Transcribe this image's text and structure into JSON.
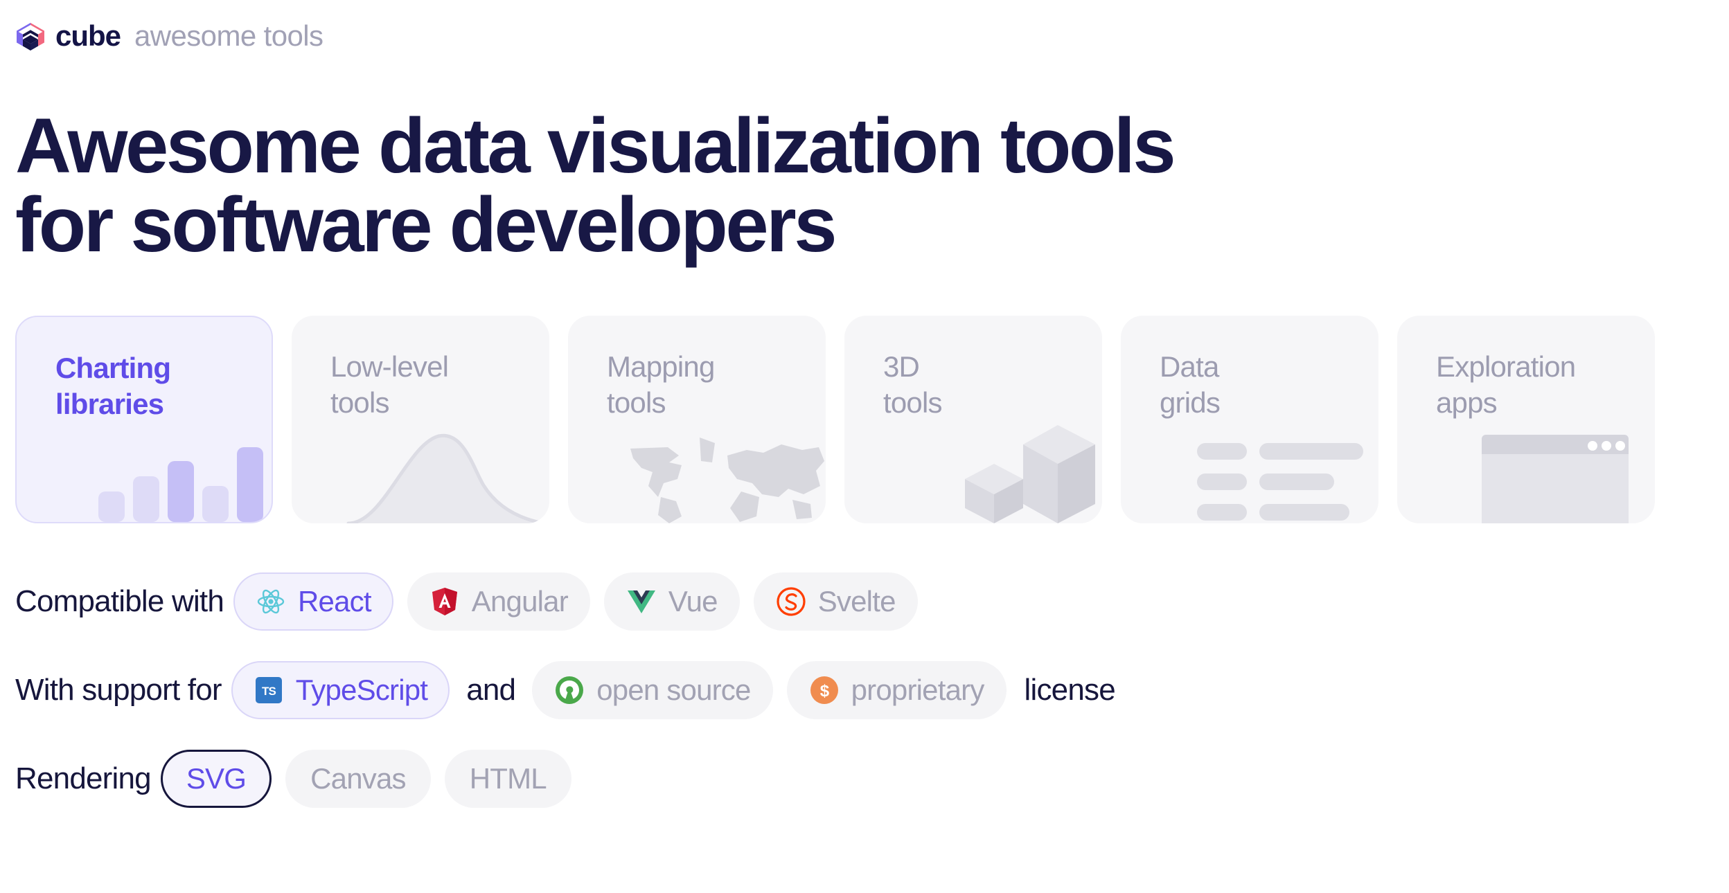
{
  "brand": {
    "logo_icon": "cube-logo-icon",
    "name": "cube",
    "tagline": "awesome tools",
    "logo_colors": {
      "left": "#7b68ee",
      "right": "#f2687f",
      "bottom": "#141446"
    }
  },
  "headline": "Awesome data visualization tools\nfor software developers",
  "theme": {
    "accent": "#5f4ce8",
    "heading": "#181845",
    "muted": "#9c9cb0",
    "chip_bg": "#f4f4f6",
    "chip_selected_bg": "#f3f2fd",
    "chip_selected_border": "#dad6f8",
    "card_bg": "#f6f6f8",
    "card_selected_bg": "#f2f1fd",
    "focus_ring": "#16163c"
  },
  "categories": [
    {
      "label": "Charting\nlibraries",
      "selected": true,
      "art": "bar-chart-art",
      "art_icon": "bar-chart-icon"
    },
    {
      "label": "Low-level\ntools",
      "selected": false,
      "art": "bell-curve-art",
      "art_icon": "bell-curve-icon"
    },
    {
      "label": "Mapping\ntools",
      "selected": false,
      "art": "world-map-art",
      "art_icon": "world-map-icon"
    },
    {
      "label": "3D\ntools",
      "selected": false,
      "art": "cubes-art",
      "art_icon": "cubes-icon"
    },
    {
      "label": "Data\ngrids",
      "selected": false,
      "art": "data-grid-art",
      "art_icon": "data-grid-icon"
    },
    {
      "label": "Exploration\napps",
      "selected": false,
      "art": "app-window-art",
      "art_icon": "app-window-icon"
    }
  ],
  "filters": {
    "frameworks": {
      "lead_text": "Compatible with",
      "options": [
        {
          "label": "React",
          "icon": "react-atom-icon",
          "selected": true
        },
        {
          "label": "Angular",
          "icon": "angular-shield-icon",
          "selected": false
        },
        {
          "label": "Vue",
          "icon": "vue-chevron-icon",
          "selected": false
        },
        {
          "label": "Svelte",
          "icon": "svelte-spiral-icon",
          "selected": false
        }
      ]
    },
    "support": {
      "lead_text": "With support for",
      "mid_text": "and",
      "tail_text": "license",
      "options": [
        {
          "label": "TypeScript",
          "icon": "typescript-ts-icon",
          "selected": true
        },
        {
          "label": "open source",
          "icon": "open-source-leaf-icon",
          "selected": false
        },
        {
          "label": "proprietary",
          "icon": "dollar-circle-icon",
          "selected": false
        }
      ]
    },
    "rendering": {
      "lead_text": "Rendering",
      "options": [
        {
          "label": "SVG",
          "selected": true,
          "focused": true
        },
        {
          "label": "Canvas",
          "selected": false,
          "focused": false
        },
        {
          "label": "HTML",
          "selected": false,
          "focused": false
        }
      ]
    }
  },
  "bar_chart_art": {
    "type": "bar",
    "values": [
      30,
      52,
      78,
      40,
      96
    ],
    "colors": [
      "#dedbf7",
      "#dedbf7",
      "#c5bff6",
      "#dedbf7",
      "#c5bff6"
    ]
  }
}
